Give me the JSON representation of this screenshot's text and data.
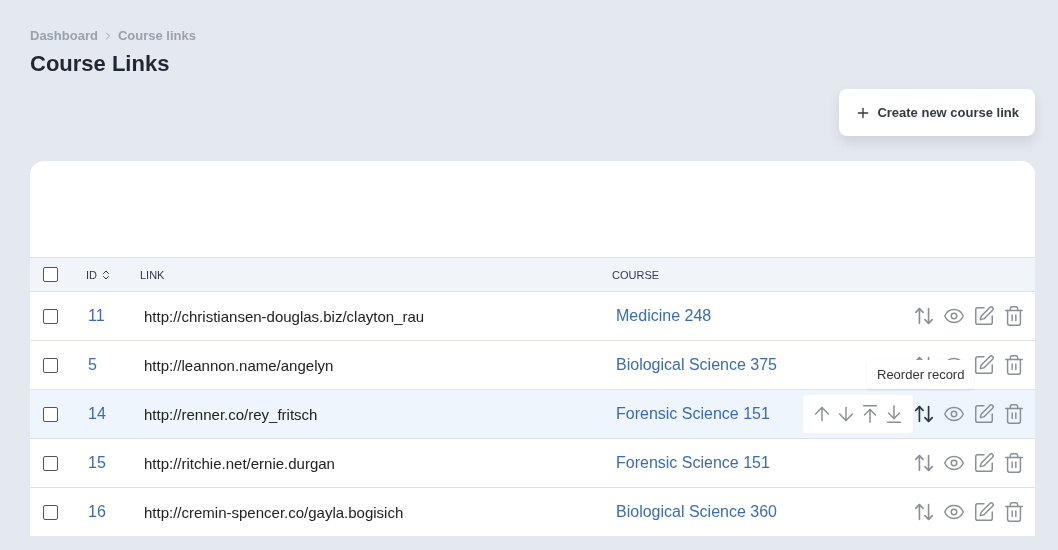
{
  "breadcrumb": [
    "Dashboard",
    "Course links"
  ],
  "title": "Course Links",
  "create_button": {
    "label": "Create new course link"
  },
  "table": {
    "columns": [
      {
        "label": "ID",
        "sortable": true
      },
      {
        "label": "LINK",
        "sortable": false
      },
      {
        "label": "COURSE",
        "sortable": false
      }
    ],
    "header_checked": false,
    "rows": [
      {
        "id": "11",
        "link": "http://christiansen-douglas.biz/clayton_rau",
        "course": "Medicine 248",
        "checked": false,
        "highlighted": false,
        "reorder_open": false
      },
      {
        "id": "5",
        "link": "http://leannon.name/angelyn",
        "course": "Biological Science 375",
        "checked": false,
        "highlighted": false,
        "reorder_open": false
      },
      {
        "id": "14",
        "link": "http://renner.co/rey_fritsch",
        "course": "Forensic Science 151",
        "checked": false,
        "highlighted": true,
        "reorder_open": true
      },
      {
        "id": "15",
        "link": "http://ritchie.net/ernie.durgan",
        "course": "Forensic Science 151",
        "checked": false,
        "highlighted": false,
        "reorder_open": false
      },
      {
        "id": "16",
        "link": "http://cremin-spencer.co/gayla.bogisich",
        "course": "Biological Science 360",
        "checked": false,
        "highlighted": false,
        "reorder_open": false
      }
    ]
  },
  "tooltip": "Reorder record"
}
